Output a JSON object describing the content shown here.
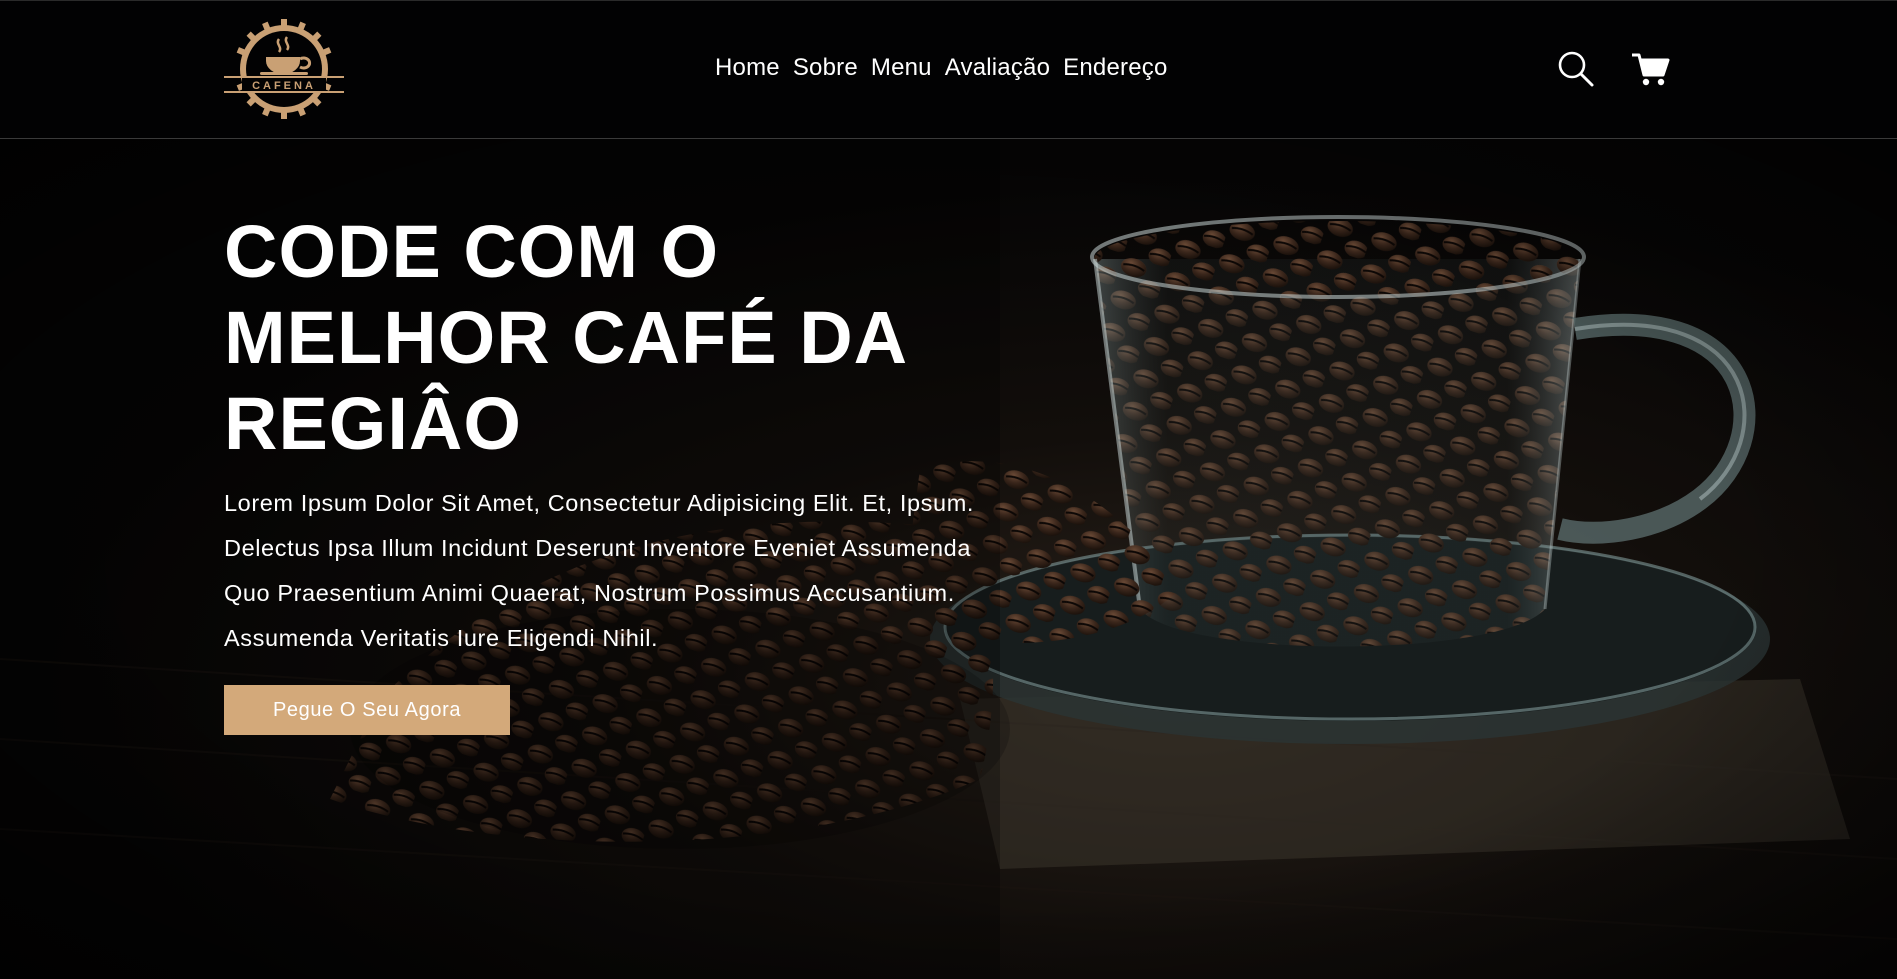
{
  "brand": {
    "name": "CAFENA",
    "accent_color": "#d3a97a"
  },
  "nav": {
    "items": [
      "Home",
      "Sobre",
      "Menu",
      "Avaliação",
      "Endereço"
    ]
  },
  "header_icons": {
    "search": "search-icon",
    "cart": "cart-icon"
  },
  "hero": {
    "title": "CODE COM O MELHOR CAFÉ DA REGIÂO",
    "description": "Lorem Ipsum Dolor Sit Amet, Consectetur Adipisicing Elit. Et, Ipsum. Delectus Ipsa Illum Incidunt Deserunt Inventore Eveniet Assumenda Quo Praesentium Animi Quaerat, Nostrum Possimus Accusantium. Assumenda Veritatis Iure Eligendi Nihil.",
    "cta_label": "Pegue O Seu Agora"
  }
}
